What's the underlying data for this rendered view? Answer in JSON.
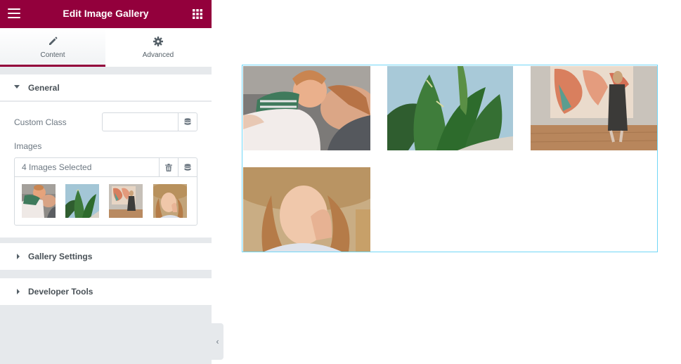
{
  "header": {
    "title": "Edit Image Gallery",
    "menu_icon": "hamburger-menu-icon",
    "apps_icon": "grid-apps-icon",
    "color": "#93003c"
  },
  "tabs": [
    {
      "label": "Content",
      "icon": "pencil-icon",
      "active": true
    },
    {
      "label": "Advanced",
      "icon": "gear-icon",
      "active": false
    }
  ],
  "sections": {
    "general": {
      "label": "General",
      "expanded": true,
      "custom_class": {
        "label": "Custom Class",
        "value": ""
      },
      "images": {
        "label": "Images",
        "count_text": "4 Images Selected",
        "thumbnails": [
          "baby-with-mother",
          "cactus-plant",
          "woman-in-gallery",
          "woman-in-hat"
        ]
      }
    },
    "gallery_settings": {
      "label": "Gallery Settings",
      "expanded": false
    },
    "developer_tools": {
      "label": "Developer Tools",
      "expanded": false
    }
  },
  "collapse_handle": {
    "glyph": "‹"
  },
  "canvas": {
    "widget_outline_color": "#71d7f7",
    "images": [
      "baby-with-mother",
      "cactus-plant",
      "woman-in-gallery",
      "woman-in-hat"
    ]
  }
}
